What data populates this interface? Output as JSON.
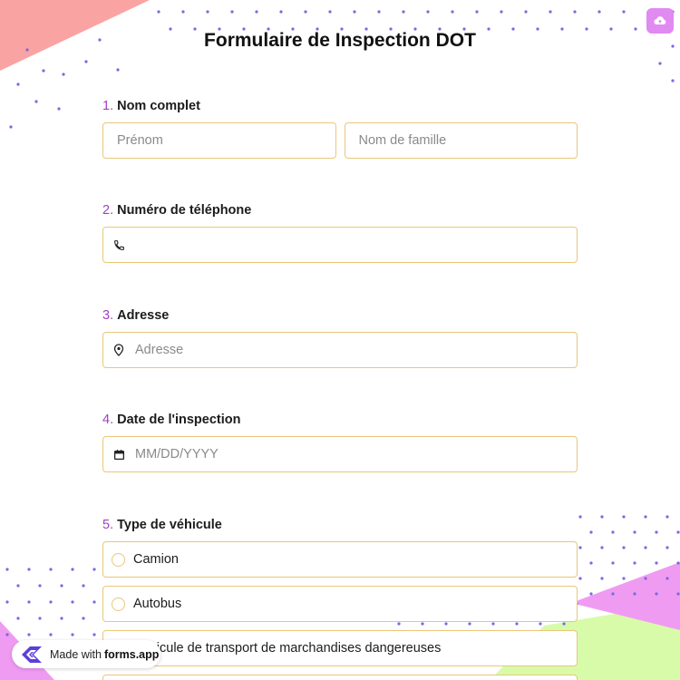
{
  "page": {
    "title": "Formulaire de Inspection DOT"
  },
  "toolbar": {
    "cloud_icon": "cloud-upload-icon"
  },
  "questions": [
    {
      "number": "1.",
      "label": "Nom complet",
      "fields": [
        {
          "placeholder": "Prénom"
        },
        {
          "placeholder": "Nom de famille"
        }
      ]
    },
    {
      "number": "2.",
      "label": "Numéro de téléphone",
      "icon": "phone-icon",
      "placeholder": ""
    },
    {
      "number": "3.",
      "label": "Adresse",
      "icon": "map-pin-icon",
      "placeholder": "Adresse"
    },
    {
      "number": "4.",
      "label": "Date de l'inspection",
      "icon": "calendar-icon",
      "placeholder": "MM/DD/YYYY"
    },
    {
      "number": "5.",
      "label": "Type de véhicule",
      "options": [
        "Camion",
        "Autobus",
        "Véhicule de transport de marchandises dangereuses"
      ]
    }
  ],
  "badge": {
    "prefix": "Made with",
    "brand": "forms.app"
  },
  "colors": {
    "accent": "#a23fc4",
    "border": "#e9c77a",
    "cloud_button": "#e08af2",
    "shape_coral": "#f9a3a3",
    "shape_pink": "#f09bf2",
    "shape_lime": "#d8fbaa",
    "dots": "#7b68e0"
  }
}
